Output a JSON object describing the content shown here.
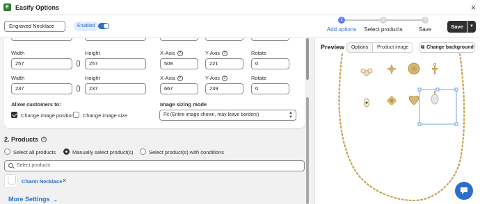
{
  "app": {
    "title": "Easify Options"
  },
  "header": {
    "option_name": "Engraved Necklace",
    "status": "Enabled",
    "steps": [
      {
        "number": "1",
        "label": "Add options",
        "active": true
      },
      {
        "number": "2",
        "label": "Select products",
        "active": false
      },
      {
        "number": "3",
        "label": "Save",
        "active": false
      }
    ],
    "save_label": "Save"
  },
  "image_layers": [
    {
      "width_label": "Width",
      "width": "257",
      "height_label": "Height",
      "height": "257",
      "x_label": "X-Axis",
      "x": "508",
      "y_label": "Y-Axis",
      "y": "221",
      "rotate_label": "Rotate",
      "rotate": "0"
    },
    {
      "width_label": "Width",
      "width": "237",
      "height_label": "Height",
      "height": "237",
      "x_label": "X-Axis",
      "x": "667",
      "y_label": "Y-Axis",
      "y": "239",
      "rotate_label": "Rotate",
      "rotate": "0"
    }
  ],
  "allow": {
    "title": "Allow customers to:",
    "change_position": {
      "label": "Change image position",
      "checked": true
    },
    "change_size": {
      "label": "Change image size",
      "checked": false
    }
  },
  "sizing": {
    "title": "Image sizing mode",
    "value": "Fit (Entire image shown, may leave borders)"
  },
  "products": {
    "title": "2. Products",
    "options": [
      {
        "label": "Select all products",
        "checked": false
      },
      {
        "label": "Manually select product(s)",
        "checked": true
      },
      {
        "label": "Select product(s) with conditions",
        "checked": false
      }
    ],
    "search_placeholder": "Select products",
    "selected": [
      {
        "name": "Charm Necklace"
      }
    ],
    "more_settings": "More Settings"
  },
  "preview": {
    "title": "Preview",
    "tabs": [
      {
        "label": "Options",
        "active": false
      },
      {
        "label": "Product image",
        "active": true
      }
    ],
    "change_background": "Change background"
  },
  "colors": {
    "accent": "#2c6ecb",
    "dark": "#303030",
    "gold": "#c9a55b"
  }
}
